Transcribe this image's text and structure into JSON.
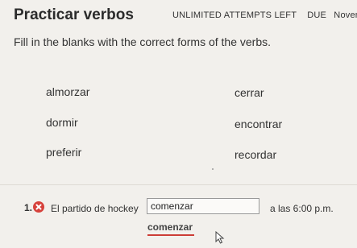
{
  "header": {
    "title": "Practicar verbos",
    "attempts": "UNLIMITED ATTEMPTS LEFT",
    "due_label": "DUE",
    "due_date": "Novem"
  },
  "instructions": "Fill in the blanks with the correct forms of the verbs.",
  "word_bank": [
    "almorzar",
    "cerrar",
    "dormir",
    "encontrar",
    "preferir",
    "recordar"
  ],
  "question": {
    "number": "1.",
    "status": "incorrect",
    "before": "El partido de hockey",
    "answer": "comenzar",
    "after": "a las 6:00 p.m.",
    "correct_answer": "comenzar"
  },
  "colors": {
    "error": "#d6413b",
    "background": "#f2f0ec"
  }
}
